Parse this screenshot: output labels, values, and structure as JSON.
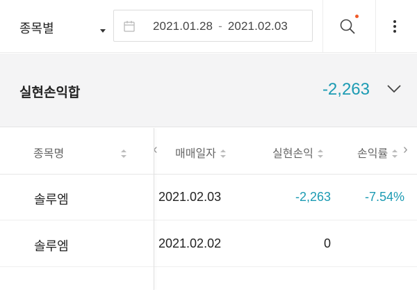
{
  "filter": {
    "group_label": "종목별",
    "date_start": "2021.01.28",
    "date_separator": "-",
    "date_end": "2021.02.03"
  },
  "summary": {
    "title": "실현손익합",
    "value": "-2,263"
  },
  "table": {
    "headers": {
      "name": "종목명",
      "date": "매매일자",
      "pnl": "실현손익",
      "rate": "손익률"
    },
    "rows": [
      {
        "name": "솔루엠",
        "date": "2021.02.03",
        "pnl": "-2,263",
        "rate": "-7.54%"
      },
      {
        "name": "솔루엠",
        "date": "2021.02.02",
        "pnl": "0",
        "rate": ""
      }
    ]
  },
  "colors": {
    "accent": "#1c9bb3",
    "notification_dot": "#f05a28",
    "summary_bg": "#f4f4f5"
  },
  "icons": {
    "calendar": "calendar-icon",
    "search": "search-icon",
    "more": "more-vertical-icon",
    "expand": "chevron-down-icon",
    "scroll_left": "chevron-left-icon",
    "scroll_right": "chevron-right-icon"
  }
}
